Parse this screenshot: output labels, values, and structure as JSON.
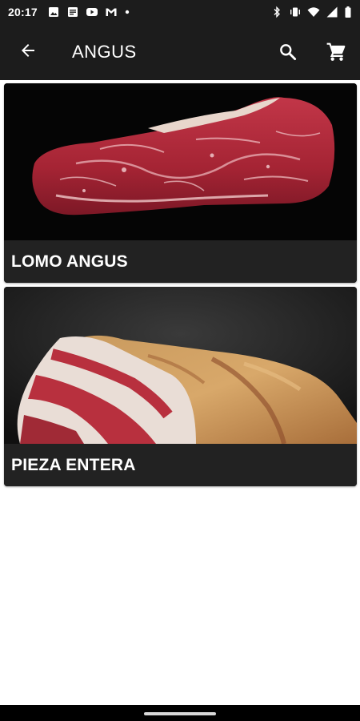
{
  "status_bar": {
    "time": "20:17",
    "left_icons": [
      "image-icon",
      "notes-icon",
      "youtube-icon",
      "gmail-icon",
      "dot-icon"
    ],
    "right_icons": [
      "bluetooth-icon",
      "vibrate-icon",
      "wifi-icon",
      "signal-icon",
      "battery-icon"
    ]
  },
  "app_bar": {
    "title": "ANGUS",
    "back_icon": "arrow-back-icon",
    "actions": [
      "search-icon",
      "cart-icon"
    ]
  },
  "products": [
    {
      "label": "LOMO ANGUS",
      "image": "steak-photo"
    },
    {
      "label": "PIEZA ENTERA",
      "image": "ribs-photo"
    }
  ],
  "colors": {
    "bar_background": "#1c1c1c",
    "card_background": "#222222",
    "page_background": "#ffffff",
    "text_on_dark": "#ffffff"
  }
}
